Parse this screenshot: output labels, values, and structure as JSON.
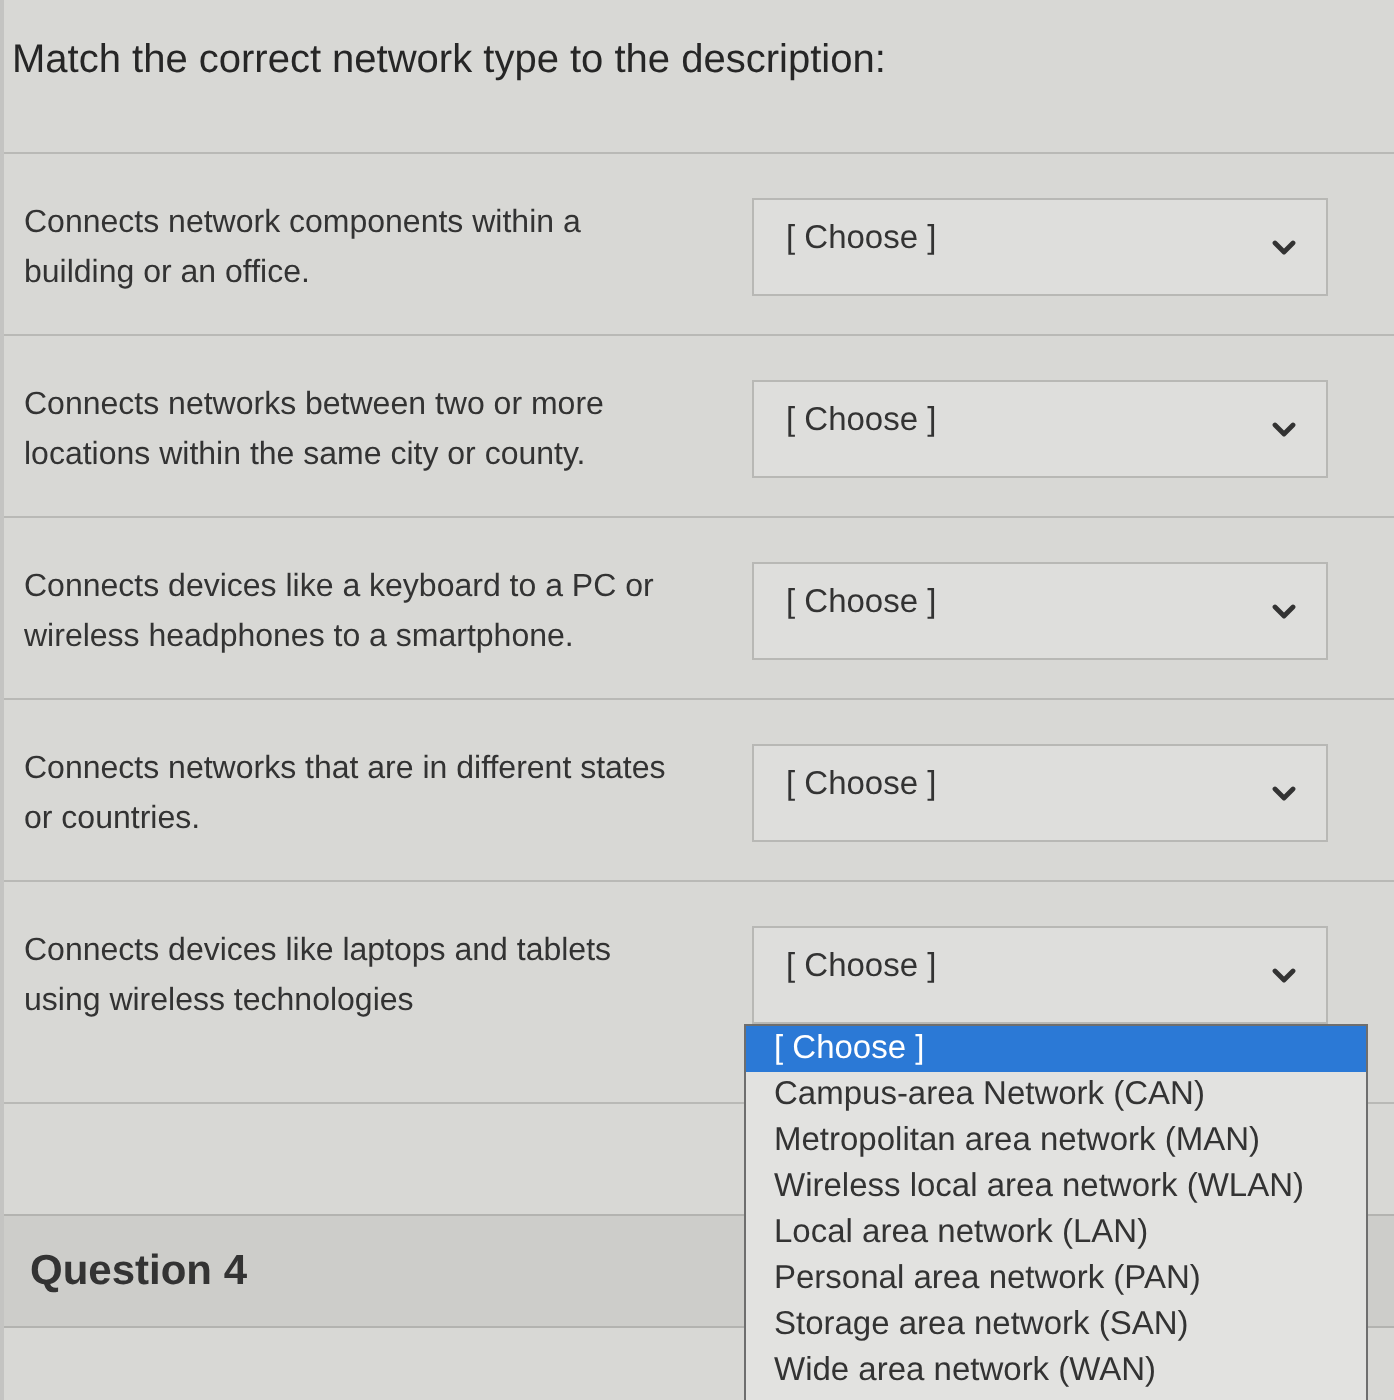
{
  "prompt": "Match the correct network type to the description:",
  "items": [
    {
      "description": "Connects network components within a building or an office.",
      "select": {
        "value": "[ Choose ]"
      }
    },
    {
      "description": "Connects networks between two or more locations within the same city or county.",
      "select": {
        "value": "[ Choose ]"
      }
    },
    {
      "description": "Connects devices like a keyboard to a PC or wireless headphones to a smartphone.",
      "select": {
        "value": "[ Choose ]"
      }
    },
    {
      "description": "Connects networks that are in different states or countries.",
      "select": {
        "value": "[ Choose ]"
      }
    },
    {
      "description": "Connects devices like laptops and tablets using wireless technologies",
      "select": {
        "value": "[ Choose ]",
        "options": [
          {
            "label": "[ Choose ]",
            "selected": true
          },
          {
            "label": "Campus-area Network (CAN)",
            "selected": false
          },
          {
            "label": "Metropolitan area network (MAN)",
            "selected": false
          },
          {
            "label": "Wireless local area network (WLAN)",
            "selected": false
          },
          {
            "label": "Local area network (LAN)",
            "selected": false
          },
          {
            "label": "Personal area network (PAN)",
            "selected": false
          },
          {
            "label": "Storage area network (SAN)",
            "selected": false
          },
          {
            "label": "Wide area network (WAN)",
            "selected": false
          }
        ]
      }
    }
  ],
  "next_question": {
    "title": "Question 4"
  }
}
